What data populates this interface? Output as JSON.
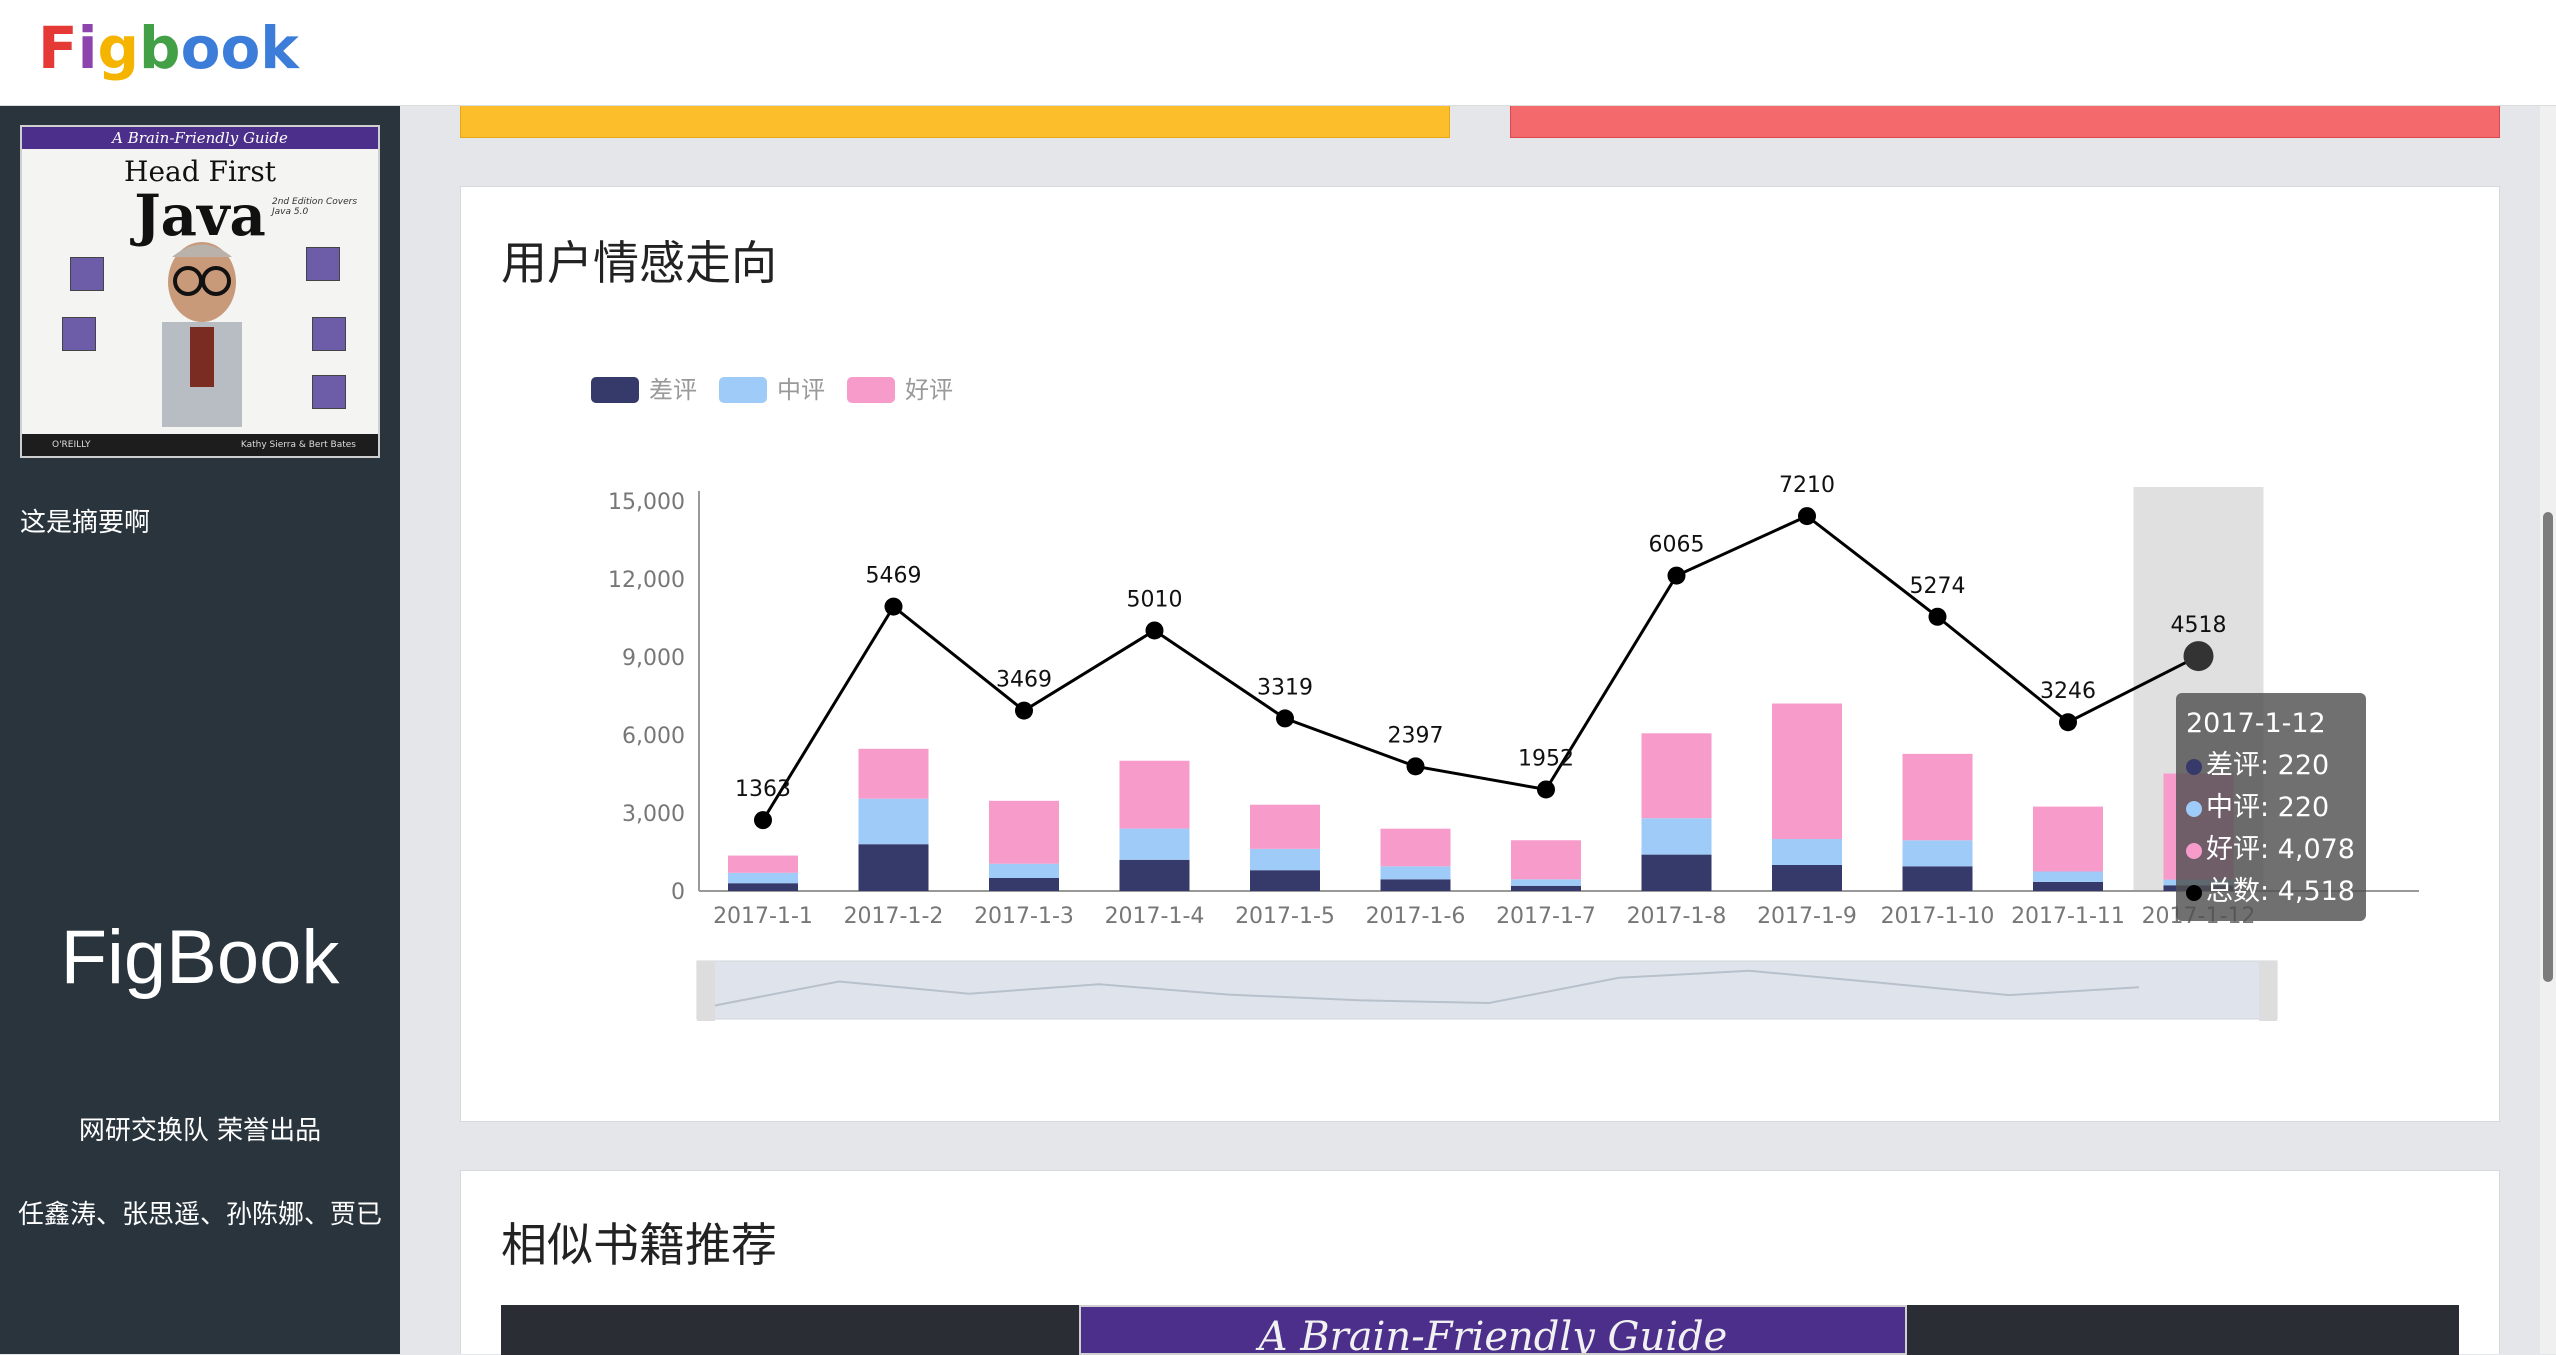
{
  "header": {
    "logo_letters": [
      {
        "ch": "F",
        "color": "#e53935"
      },
      {
        "ch": "i",
        "color": "#8e44ad"
      },
      {
        "ch": "g",
        "color": "#f5b400"
      },
      {
        "ch": "b",
        "color": "#43a047"
      },
      {
        "ch": "o",
        "color": "#3b7dd8"
      },
      {
        "ch": "o",
        "color": "#3b7dd8"
      },
      {
        "ch": "k",
        "color": "#3b7dd8"
      }
    ]
  },
  "sidebar": {
    "cover": {
      "band": "A Brain-Friendly Guide",
      "title_line1": "Head First",
      "title_line2": "Java",
      "edition": "2nd Edition Covers Java 5.0",
      "publisher": "O'REILLY",
      "authors": "Kathy Sierra & Bert Bates"
    },
    "summary": "这是摘要啊",
    "brand": "FigBook",
    "credit": "网研交换队 荣誉出品",
    "team": "任鑫涛、张思遥、孙陈娜、贾已"
  },
  "chart_panel": {
    "title": "用户情感走向"
  },
  "tooltip": {
    "date": "2017-1-12",
    "rows": [
      {
        "label": "差评: 220",
        "color": "#363a6a"
      },
      {
        "label": "中评: 220",
        "color": "#9ecbf7"
      },
      {
        "label": "好评: 4,078",
        "color": "#f79bcb"
      },
      {
        "label": "总数: 4,518",
        "color": "#000000"
      }
    ]
  },
  "chart_data": {
    "type": "bar",
    "categories": [
      "2017-1-1",
      "2017-1-2",
      "2017-1-3",
      "2017-1-4",
      "2017-1-5",
      "2017-1-6",
      "2017-1-7",
      "2017-1-8",
      "2017-1-9",
      "2017-1-10",
      "2017-1-11",
      "2017-1-12"
    ],
    "series": [
      {
        "name": "差评",
        "color": "#363a6a",
        "stack": true,
        "values": [
          300,
          1800,
          500,
          1200,
          800,
          450,
          200,
          1400,
          1000,
          950,
          350,
          220
        ]
      },
      {
        "name": "中评",
        "color": "#9ecbf7",
        "stack": true,
        "values": [
          400,
          1750,
          550,
          1200,
          820,
          500,
          250,
          1400,
          1000,
          1000,
          400,
          220
        ]
      },
      {
        "name": "好评",
        "color": "#f79bcb",
        "stack": true,
        "values": [
          663,
          1919,
          2419,
          2610,
          1699,
          1447,
          1502,
          3265,
          5210,
          3324,
          2496,
          4078
        ]
      },
      {
        "name": "总数",
        "color": "#000000",
        "type": "line",
        "values": [
          1363,
          5469,
          3469,
          5010,
          3319,
          2397,
          1952,
          6065,
          7210,
          5274,
          3246,
          4518
        ]
      }
    ],
    "legend": [
      "差评",
      "中评",
      "好评"
    ],
    "legend_position": "top-left",
    "y_ticks": [
      "0",
      "3,000",
      "6,000",
      "9,000",
      "12,000",
      "15,000"
    ],
    "ylim": [
      0,
      15000
    ],
    "line_axis_max": 7500,
    "highlighted_category": "2017-1-12",
    "datazoom_slider": true
  },
  "similar_panel": {
    "title": "相似书籍推荐",
    "cover_band": "A Brain-Friendly Guide"
  }
}
